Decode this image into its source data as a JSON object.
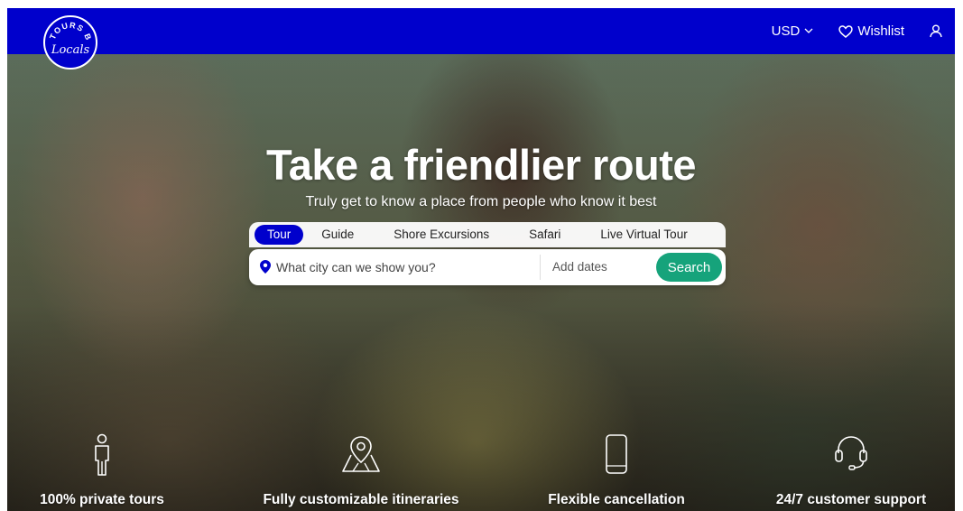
{
  "header": {
    "logo_text_top": "TOURS BY",
    "logo_text_script": "Locals",
    "currency": "USD",
    "wishlist": "Wishlist",
    "icons": {
      "currency_chevron": "chevron-down-icon",
      "wishlist": "heart-icon",
      "account": "user-icon"
    }
  },
  "hero": {
    "title": "Take a friendlier route",
    "subtitle": "Truly get to know a place from people who know it best"
  },
  "search": {
    "tabs": [
      {
        "label": "Tour",
        "active": true
      },
      {
        "label": "Guide",
        "active": false
      },
      {
        "label": "Shore Excursions",
        "active": false
      },
      {
        "label": "Safari",
        "active": false
      },
      {
        "label": "Live Virtual Tour",
        "active": false
      }
    ],
    "city_placeholder": "What city can we show you?",
    "dates_label": "Add dates",
    "button_label": "Search"
  },
  "features": [
    {
      "icon": "person-icon",
      "label": "100% private tours"
    },
    {
      "icon": "map-pin-icon",
      "label": "Fully customizable itineraries"
    },
    {
      "icon": "phone-icon",
      "label": "Flexible cancellation"
    },
    {
      "icon": "headset-icon",
      "label": "24/7 customer support"
    }
  ],
  "colors": {
    "brand_blue": "#0000cc",
    "search_green": "#16a37b",
    "white": "#ffffff"
  }
}
